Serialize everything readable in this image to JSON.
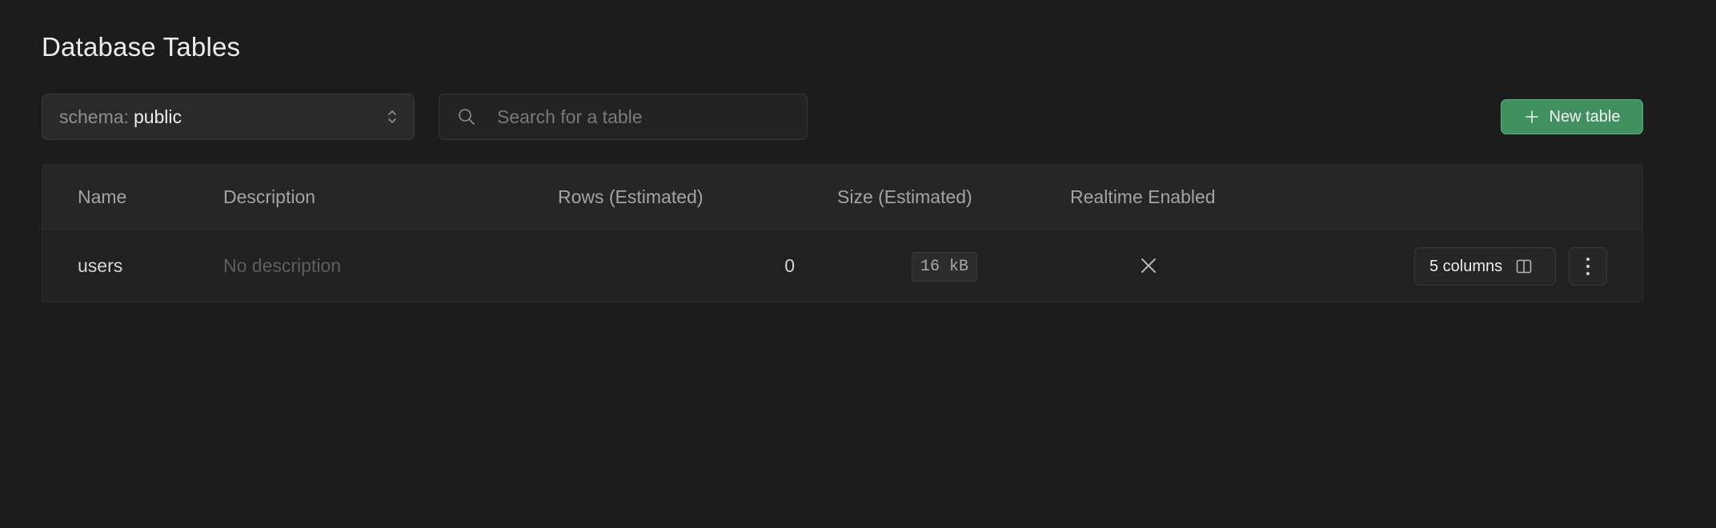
{
  "page": {
    "title": "Database Tables"
  },
  "toolbar": {
    "schema_prefix": "schema:",
    "schema_value": "public",
    "search_placeholder": "Search for a table",
    "search_value": "",
    "new_table_label": "New table"
  },
  "table": {
    "columns": [
      "Name",
      "Description",
      "Rows (Estimated)",
      "Size (Estimated)",
      "Realtime Enabled"
    ],
    "rows": [
      {
        "name": "users",
        "description": "No description",
        "rows_estimated": "0",
        "size_estimated": "16 kB",
        "realtime_enabled": false,
        "columns_label": "5 columns"
      }
    ]
  },
  "icons": {
    "schema_select": "chevron-up-down-icon",
    "search": "search-icon",
    "new_table": "plus-icon",
    "realtime_disabled": "x-icon",
    "columns": "columns-icon",
    "row_actions": "kebab-menu-icon"
  },
  "colors": {
    "background": "#1c1c1c",
    "brand_green": "#3f8f5f",
    "brand_green_border": "#5bb17c"
  }
}
